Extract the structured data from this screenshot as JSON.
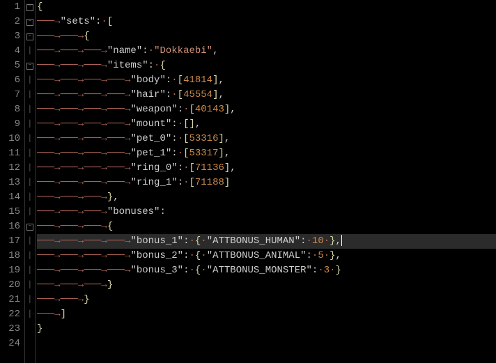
{
  "lines": {
    "count": 24,
    "numbers": [
      "1",
      "2",
      "3",
      "4",
      "5",
      "6",
      "7",
      "8",
      "9",
      "10",
      "11",
      "12",
      "13",
      "14",
      "15",
      "16",
      "17",
      "18",
      "19",
      "20",
      "21",
      "22",
      "23",
      "24"
    ],
    "fold": [
      "−",
      "−",
      "−",
      "",
      "−",
      "",
      "",
      "",
      "",
      "",
      "",
      "",
      "",
      "",
      "",
      "−",
      "",
      "",
      "",
      "",
      "",
      "",
      "",
      ""
    ]
  },
  "current_line": 17,
  "tokens": {
    "sets": "\"sets\"",
    "name": "\"name\"",
    "items": "\"items\"",
    "body": "\"body\"",
    "hair": "\"hair\"",
    "weapon": "\"weapon\"",
    "mount": "\"mount\"",
    "pet0": "\"pet_0\"",
    "pet1": "\"pet_1\"",
    "ring0": "\"ring_0\"",
    "ring1": "\"ring_1\"",
    "bonuses": "\"bonuses\"",
    "bonus1": "\"bonus_1\"",
    "bonus2": "\"bonus_2\"",
    "bonus3": "\"bonus_3\"",
    "dokkaebi": "\"Dokkaebi\"",
    "ah": "\"ATTBONUS_HUMAN\"",
    "aa": "\"ATTBONUS_ANIMAL\"",
    "am": "\"ATTBONUS_MONSTER\""
  },
  "numbers": {
    "body": "41814",
    "hair": "45554",
    "weapon": "40143",
    "pet0": "53316",
    "pet1": "53317",
    "ring0": "71136",
    "ring1": "71188",
    "b1": "10",
    "b2": "5",
    "b3": "3"
  }
}
